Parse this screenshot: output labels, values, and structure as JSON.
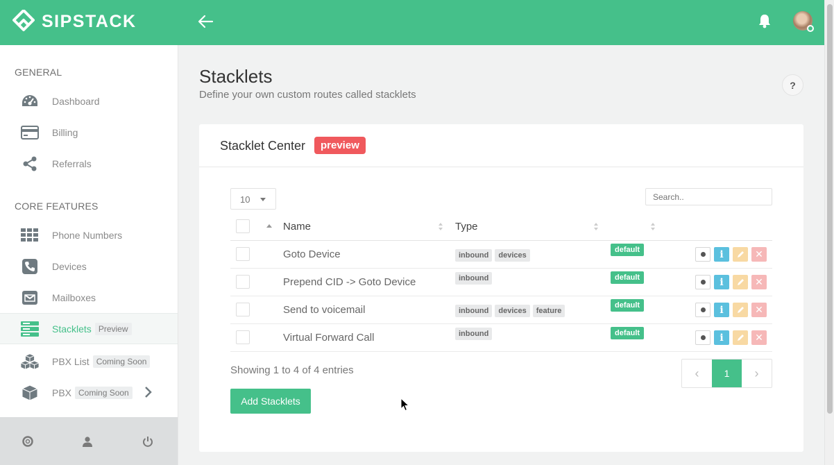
{
  "brand": {
    "name": "SIPSTACK",
    "color": "#45c08a"
  },
  "header": {
    "back_icon": "arrow-left-icon",
    "bell_icon": "bell-icon",
    "avatar": "user-avatar"
  },
  "sidebar": {
    "general_title": "GENERAL",
    "general_items": [
      {
        "label": "Dashboard",
        "icon": "speedometer-icon"
      },
      {
        "label": "Billing",
        "icon": "credit-card-icon"
      },
      {
        "label": "Referrals",
        "icon": "share-icon"
      }
    ],
    "core_title": "CORE FEATURES",
    "core_items": [
      {
        "label": "Phone Numbers",
        "icon": "grid-icon"
      },
      {
        "label": "Devices",
        "icon": "phone-icon"
      },
      {
        "label": "Mailboxes",
        "icon": "envelope-icon"
      },
      {
        "label": "Stacklets",
        "icon": "server-icon",
        "tag": "Preview",
        "active": true
      },
      {
        "label": "PBX List",
        "icon": "cubes-icon",
        "tag": "Coming Soon"
      },
      {
        "label": "PBX",
        "icon": "cube-icon",
        "tag": "Coming Soon"
      }
    ],
    "footer_icons": [
      "lifebuoy-icon",
      "user-icon",
      "power-icon"
    ]
  },
  "page": {
    "title": "Stacklets",
    "subtitle": "Define your own custom routes called stacklets",
    "help": "?"
  },
  "card": {
    "title": "Stacklet Center",
    "badge": "preview",
    "page_length": "10",
    "search_placeholder": "Search..",
    "columns": {
      "name": "Name",
      "type": "Type"
    },
    "rows": [
      {
        "name": "Goto Device",
        "types": [
          "inbound",
          "devices"
        ],
        "status": "default"
      },
      {
        "name": "Prepend CID -> Goto Device",
        "types": [
          "inbound"
        ],
        "status": "default"
      },
      {
        "name": "Send to voicemail",
        "types": [
          "inbound",
          "devices",
          "feature"
        ],
        "status": "default"
      },
      {
        "name": "Virtual Forward Call",
        "types": [
          "inbound"
        ],
        "status": "default"
      }
    ],
    "showing": "Showing 1 to 4 of 4 entries",
    "current_page": "1",
    "add_button": "Add Stacklets"
  }
}
